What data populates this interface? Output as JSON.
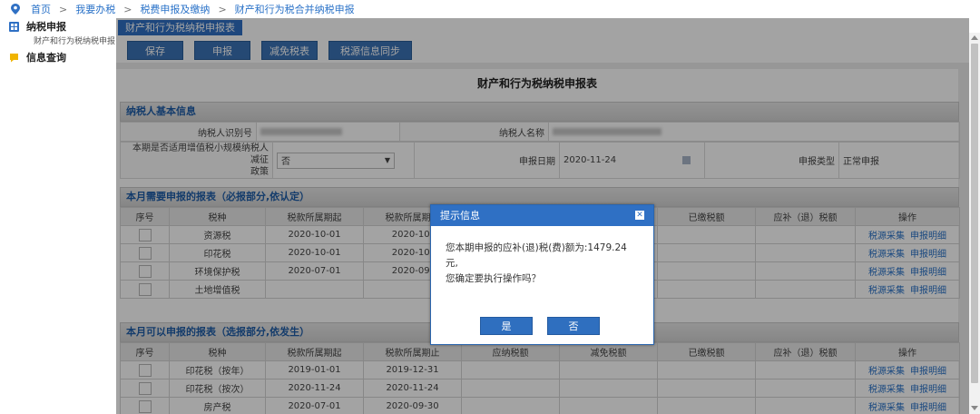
{
  "breadcrumb": [
    "首页",
    "我要办税",
    "税费申报及缴纳",
    "财产和行为税合并纳税申报"
  ],
  "sidebar": {
    "groups": [
      {
        "label": "纳税申报",
        "icon": "grid-icon",
        "sub": [
          "财产和行为税纳税申报"
        ]
      },
      {
        "label": "信息查询",
        "icon": "chat-icon",
        "sub": []
      }
    ]
  },
  "tab": {
    "label": "财产和行为税纳税申报表"
  },
  "toolbar": {
    "save": "保存",
    "submit": "申报",
    "relief": "减免税表",
    "sync": "税源信息同步"
  },
  "form": {
    "title": "财产和行为税纳税申报表",
    "basic": {
      "header": "纳税人基本信息",
      "taxpayer_id_label": "纳税人识别号",
      "taxpayer_name_label": "纳税人名称",
      "policy_label_1": "本期是否适用增值税小规模纳税人减征",
      "policy_label_2": "政策",
      "policy_value": "否",
      "date_label": "申报日期",
      "date_value": "2020-11-24",
      "type_label": "申报类型",
      "type_value": "正常申报"
    },
    "required": {
      "header": "本月需要申报的报表（必报部分,依认定）",
      "columns": [
        "序号",
        "税种",
        "税款所属期起",
        "税款所属期止",
        "",
        "",
        "已缴税额",
        "应补（退）税额",
        "操作"
      ],
      "rows": [
        {
          "tax": "资源税",
          "start": "2020-10-01",
          "end": "2020-10-"
        },
        {
          "tax": "印花税",
          "start": "2020-10-01",
          "end": "2020-10-"
        },
        {
          "tax": "环境保护税",
          "start": "2020-07-01",
          "end": "2020-09-"
        },
        {
          "tax": "土地增值税",
          "start": "",
          "end": ""
        }
      ]
    },
    "optional": {
      "header": "本月可以申报的报表（选报部分,依发生）",
      "columns": [
        "序号",
        "税种",
        "税款所属期起",
        "税款所属期止",
        "应纳税额",
        "减免税额",
        "已缴税额",
        "应补（退）税额",
        "操作"
      ],
      "rows": [
        {
          "tax": "印花税（按年）",
          "start": "2019-01-01",
          "end": "2019-12-31"
        },
        {
          "tax": "印花税（按次）",
          "start": "2020-11-24",
          "end": "2020-11-24"
        },
        {
          "tax": "房产税",
          "start": "2020-07-01",
          "end": "2020-09-30"
        }
      ]
    },
    "actions": {
      "collect": "税源采集",
      "detail": "申报明细"
    }
  },
  "dialog": {
    "title": "提示信息",
    "line1": "您本期申报的应补(退)税(费)额为:1479.24元,",
    "line2": "您确定要执行操作吗？",
    "yes": "是",
    "no": "否"
  }
}
